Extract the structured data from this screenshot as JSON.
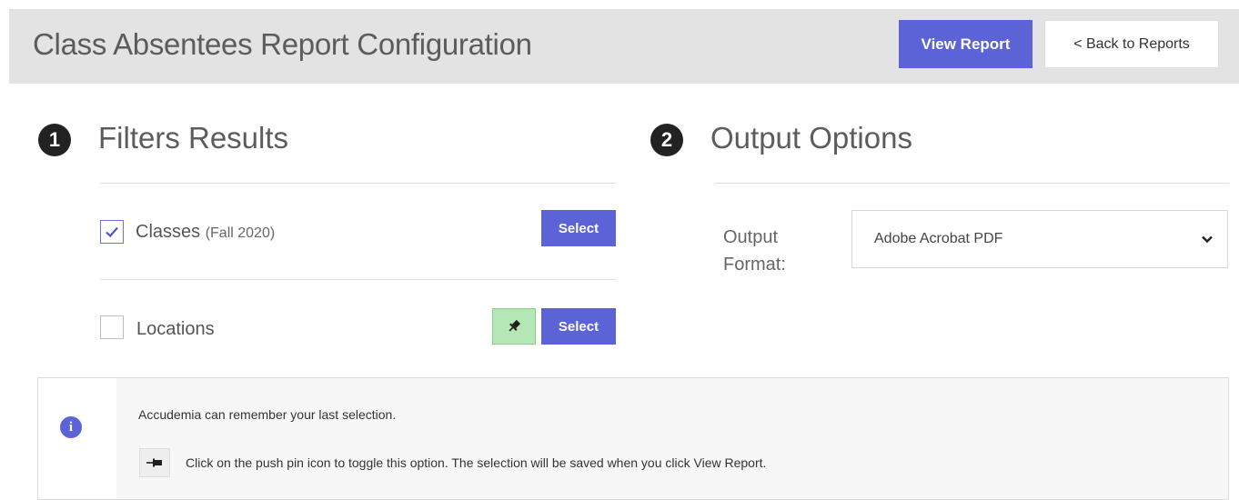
{
  "header": {
    "title": "Class Absentees Report Configuration",
    "view_report_label": "View Report",
    "back_label": "< Back to Reports"
  },
  "filters": {
    "step": "1",
    "title": "Filters Results",
    "items": [
      {
        "label": "Classes",
        "sublabel": "(Fall 2020)",
        "checked": true,
        "select_label": "Select"
      },
      {
        "label": "Locations",
        "sublabel": "",
        "checked": false,
        "select_label": "Select",
        "pinned": true
      }
    ]
  },
  "output": {
    "step": "2",
    "title": "Output Options",
    "format_label_line1": "Output",
    "format_label_line2": "Format:",
    "format_value": "Adobe Acrobat PDF"
  },
  "info": {
    "line1": "Accudemia can remember your last selection.",
    "line2": "Click on the push pin icon to toggle this option. The selection will be saved when you click View Report."
  },
  "colors": {
    "accent": "#5b63d6",
    "header_bg": "#e3e3e3",
    "pin_active": "#b5e6b5"
  }
}
